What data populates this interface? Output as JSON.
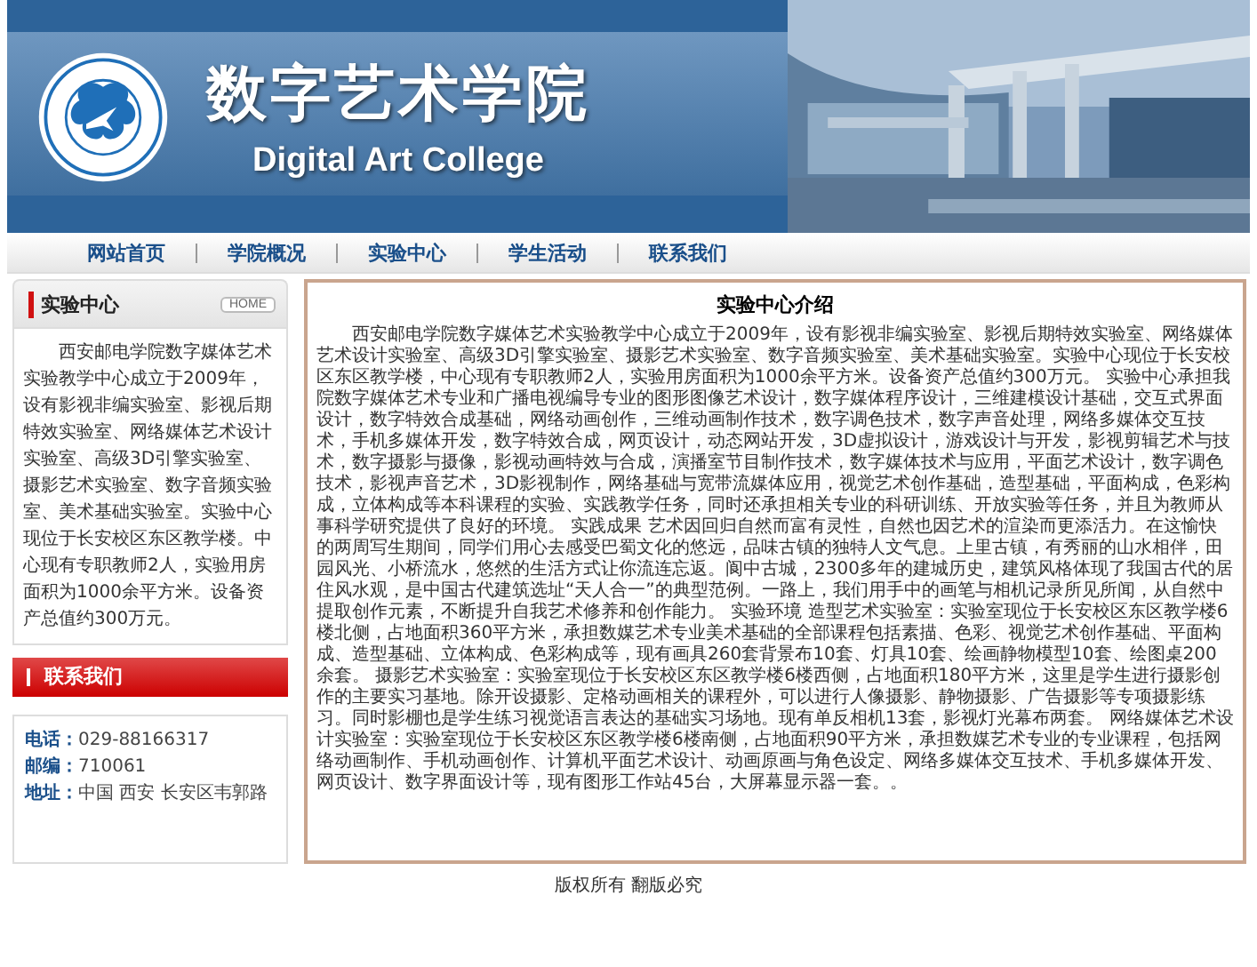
{
  "header": {
    "title": "数字艺术学院",
    "subtitle": "Digital Art College"
  },
  "nav": [
    {
      "label": "网站首页"
    },
    {
      "label": "学院概况"
    },
    {
      "label": "实验中心"
    },
    {
      "label": "学生活动"
    },
    {
      "label": "联系我们"
    }
  ],
  "sidebar": {
    "about": {
      "title": "实验中心",
      "button": "HOME",
      "text": "西安邮电学院数字媒体艺术实验教学中心成立于2009年，设有影视非编实验室、影视后期特效实验室、网络媒体艺术设计实验室、高级3D引擎实验室、摄影艺术实验室、数字音频实验室、美术基础实验室。实验中心现位于长安校区东区教学楼。中心现有专职教师2人，实验用房面积为1000余平方米。设备资产总值约300万元。"
    },
    "contact": {
      "title": "联系我们",
      "items": [
        {
          "label": "电话：",
          "value": "029-88166317"
        },
        {
          "label": "邮编：",
          "value": "710061"
        },
        {
          "label": "地址：",
          "value": "中国 西安 长安区韦郭路"
        }
      ]
    }
  },
  "article": {
    "title": "实验中心介绍",
    "text": "西安邮电学院数字媒体艺术实验教学中心成立于2009年，设有影视非编实验室、影视后期特效实验室、网络媒体艺术设计实验室、高级3D引擎实验室、摄影艺术实验室、数字音频实验室、美术基础实验室。实验中心现位于长安校区东区教学楼，中心现有专职教师2人，实验用房面积为1000余平方米。设备资产总值约300万元。 实验中心承担我院数字媒体艺术专业和广播电视编导专业的图形图像艺术设计，数字媒体程序设计，三维建模设计基础，交互式界面设计，数字特效合成基础，网络动画创作，三维动画制作技术，数字调色技术，数字声音处理，网络多媒体交互技术，手机多媒体开发，数字特效合成，网页设计，动态网站开发，3D虚拟设计，游戏设计与开发，影视剪辑艺术与技术，数字摄影与摄像，影视动画特效与合成，演播室节目制作技术，数字媒体技术与应用，平面艺术设计，数字调色技术，影视声音艺术，3D影视制作，网络基础与宽带流媒体应用，视觉艺术创作基础，造型基础，平面构成，色彩构成，立体构成等本科课程的实验、实践教学任务，同时还承担相关专业的科研训练、开放实验等任务，并且为教师从事科学研究提供了良好的环境。 实践成果 艺术因回归自然而富有灵性，自然也因艺术的渲染而更添活力。在这愉快的两周写生期间，同学们用心去感受巴蜀文化的悠远，品味古镇的独特人文气息。上里古镇，有秀丽的山水相伴，田园风光、小桥流水，悠然的生活方式让你流连忘返。阆中古城，2300多年的建城历史，建筑风格体现了我国古代的居住风水观，是中国古代建筑选址“天人合一”的典型范例。一路上，我们用手中的画笔与相机记录所见所闻，从自然中提取创作元素，不断提升自我艺术修养和创作能力。 实验环境 造型艺术实验室：实验室现位于长安校区东区教学楼6楼北侧，占地面积360平方米，承担数媒艺术专业美术基础的全部课程包括素描、色彩、视觉艺术创作基础、平面构成、造型基础、立体构成、色彩构成等，现有画具260套背景布10套、灯具10套、绘画静物模型10套、绘图桌200余套。 摄影艺术实验室：实验室现位于长安校区东区教学楼6楼西侧，占地面积180平方米，这里是学生进行摄影创作的主要实习基地。除开设摄影、定格动画相关的课程外，可以进行人像摄影、静物摄影、广告摄影等专项摄影练习。同时影棚也是学生练习视觉语言表达的基础实习场地。现有单反相机13套，影视灯光幕布两套。 网络媒体艺术设计实验室：实验室现位于长安校区东区教学楼6楼南侧，占地面积90平方米，承担数媒艺术专业的专业课程，包括网络动画制作、手机动画创作、计算机平面艺术设计、动画原画与角色设定、网络多媒体交互技术、手机多媒体开发、网页设计、数字界面设计等，现有图形工作站45台，大屏幕显示器一套。。"
  },
  "footer": "版权所有 翻版必究"
}
